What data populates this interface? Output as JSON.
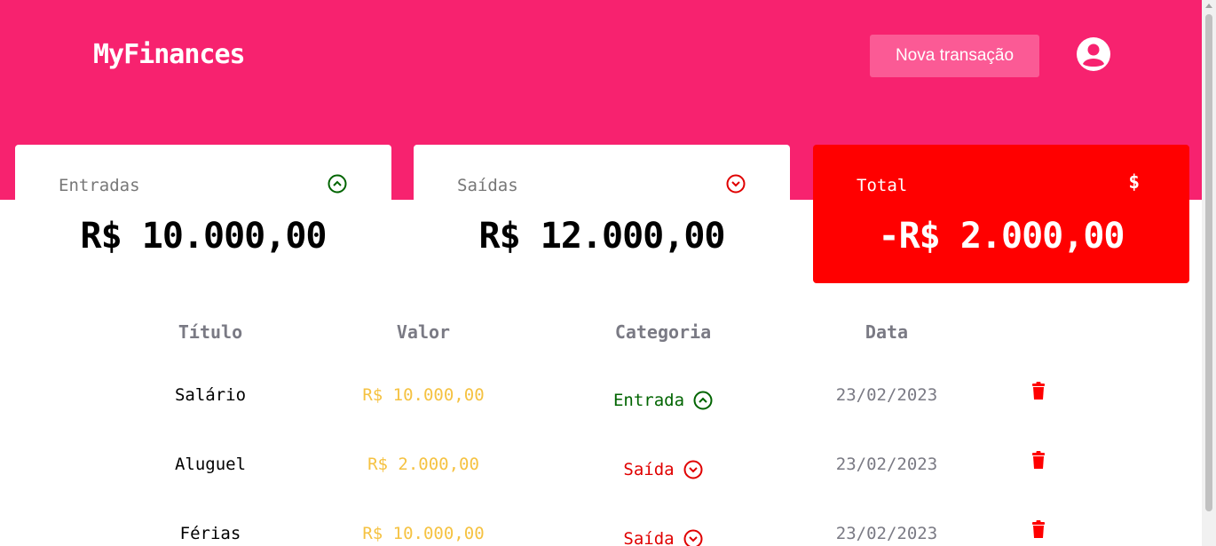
{
  "header": {
    "logo": "MyFinances",
    "new_transaction_label": "Nova transação",
    "avatar_icon": "user-circle-icon",
    "background": "#f7226f",
    "button_background": "#fb5a95"
  },
  "summary": {
    "income": {
      "label": "Entradas",
      "value": "R$ 10.000,00",
      "icon": "arrow-up-circle-icon",
      "icon_color": "#006400"
    },
    "expenses": {
      "label": "Saídas",
      "value": "R$ 12.000,00",
      "icon": "arrow-down-circle-icon",
      "icon_color": "#e00000"
    },
    "total": {
      "label": "Total",
      "symbol": "$",
      "value": "-R$ 2.000,00",
      "background": "#ff0000"
    }
  },
  "table": {
    "columns": [
      "Título",
      "Valor",
      "Categoria",
      "Data"
    ],
    "rows": [
      {
        "title": "Salário",
        "value": "R$ 10.000,00",
        "category": "Entrada",
        "type": "in",
        "date": "23/02/2023"
      },
      {
        "title": "Aluguel",
        "value": "R$ 2.000,00",
        "category": "Saída",
        "type": "out",
        "date": "23/02/2023"
      },
      {
        "title": "Férias",
        "value": "R$ 10.000,00",
        "category": "Saída",
        "type": "out",
        "date": "23/02/2023"
      }
    ],
    "delete_icon": "trash-icon",
    "value_color": "#f5c242"
  }
}
